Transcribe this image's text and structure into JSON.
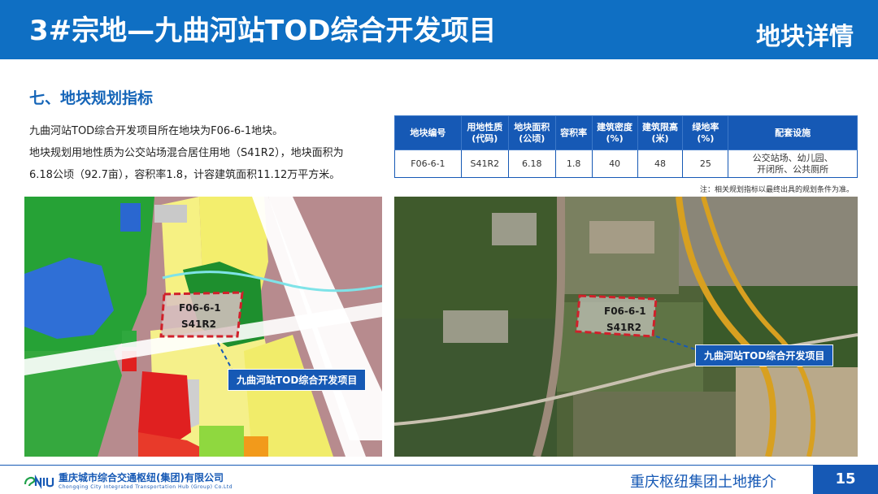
{
  "header": {
    "title": "3#宗地—九曲河站TOD综合开发项目",
    "right": "地块详情"
  },
  "section_title": "七、地块规划指标",
  "description": [
    "九曲河站TOD综合开发项目所在地块为F06-6-1地块。",
    "地块规划用地性质为公交站场混合居住用地（S41R2），地块面积为",
    "6.18公顷（92.7亩），容积率1.8，计容建筑面积11.12万平方米。"
  ],
  "table": {
    "headers": [
      [
        "地块编号"
      ],
      [
        "用地性质",
        "(代码)"
      ],
      [
        "地块面积",
        "(公顷)"
      ],
      [
        "容积率"
      ],
      [
        "建筑密度",
        "(%)"
      ],
      [
        "建筑限高",
        "(米)"
      ],
      [
        "绿地率",
        "(%)"
      ],
      [
        "配套设施"
      ]
    ],
    "row": [
      "F06-6-1",
      "S41R2",
      "6.18",
      "1.8",
      "40",
      "48",
      "25"
    ],
    "facilities": [
      "公交站场、幼儿园、",
      "开闭所、公共厕所"
    ],
    "note": "注：相关规划指标以最终出具的规划条件为准。"
  },
  "map_left": {
    "parcel_id": "F06-6-1",
    "parcel_code": "S41R2",
    "callout": "九曲河站TOD综合开发项目"
  },
  "map_right": {
    "parcel_id": "F06-6-1",
    "parcel_code": "S41R2",
    "callout": "九曲河站TOD综合开发项目"
  },
  "footer": {
    "company_cn": "重庆城市综合交通枢纽(集团)有限公司",
    "company_en": "Chongqing City Integrated Transportation Hub (Group) Co.Ltd",
    "right_text": "重庆枢纽集团土地推介",
    "page": "15"
  },
  "colors": {
    "brand_blue": "#1659b5",
    "header_blue": "#0f6fc3",
    "parcel_outline": "#d0202a"
  }
}
